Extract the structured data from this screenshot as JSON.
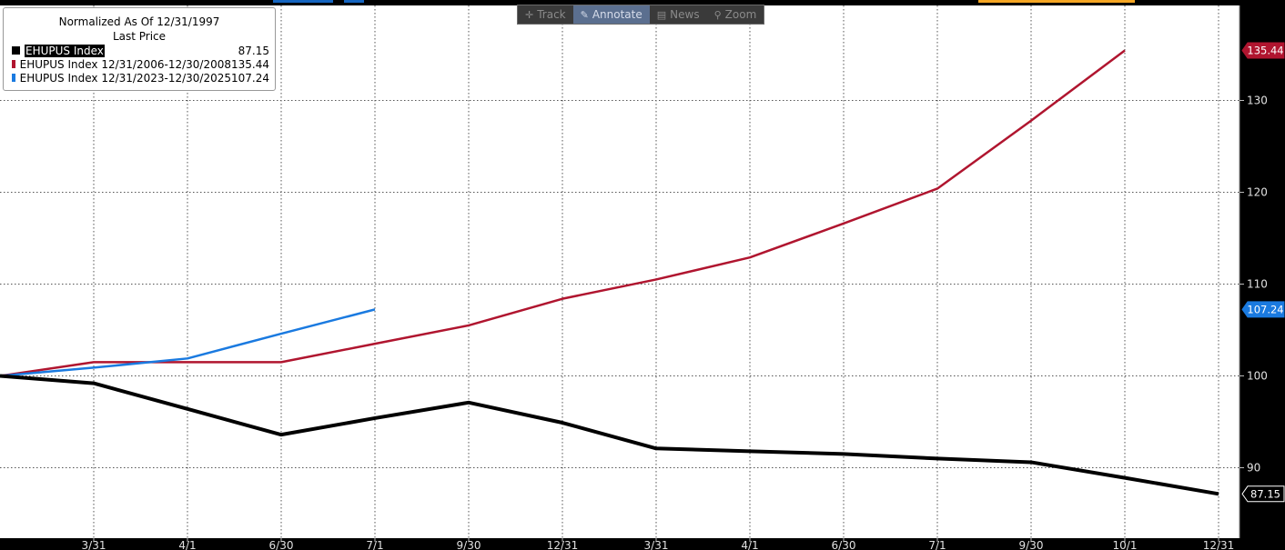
{
  "toolbar": {
    "track": "Track",
    "annotate": "Annotate",
    "news": "News",
    "zoom": "Zoom"
  },
  "legend": {
    "title": "Normalized As Of 12/31/1997",
    "subtitle": "Last Price",
    "rows": [
      {
        "name": "EHUPUS Index",
        "value": "87.15"
      },
      {
        "name": "EHUPUS Index 12/31/2006-12/30/2008",
        "value": "135.44"
      },
      {
        "name": "EHUPUS Index 12/31/2023-12/30/2025",
        "value": "107.24"
      }
    ]
  },
  "colors": {
    "background": "#000000",
    "series_black": "#000000",
    "series_red": "#b0152f",
    "series_blue": "#1a7ae0",
    "top_bar_blue": "#1565c0",
    "top_bar_orange": "#f5a623"
  },
  "chart_data": {
    "type": "line",
    "categories": [
      "12/31",
      "3/31",
      "4/1",
      "6/30",
      "7/1",
      "9/30",
      "12/31",
      "3/31",
      "4/1",
      "6/30",
      "7/1",
      "9/30",
      "10/1",
      "12/31"
    ],
    "ylim": [
      85,
      140
    ],
    "yticks": [
      90,
      100,
      110,
      120,
      130
    ],
    "grid": true,
    "legend_position": "top-left",
    "series": [
      {
        "name": "EHUPUS Index",
        "color": "#000000",
        "values": [
          100,
          99.2,
          96.4,
          93.6,
          95.4,
          97.1,
          94.9,
          92.1,
          91.8,
          91.5,
          91.0,
          90.6,
          88.9,
          87.15
        ]
      },
      {
        "name": "EHUPUS Index 12/31/2006-12/30/2008",
        "color": "#b0152f",
        "values": [
          100,
          101.5,
          101.5,
          101.5,
          103.5,
          105.5,
          108.4,
          110.5,
          112.9,
          116.6,
          120.4,
          127.8,
          135.44,
          null
        ]
      },
      {
        "name": "EHUPUS Index 12/31/2023-12/30/2025",
        "color": "#1a7ae0",
        "values": [
          100,
          100.9,
          101.9,
          104.6,
          107.24,
          null,
          null,
          null,
          null,
          null,
          null,
          null,
          null,
          null
        ]
      }
    ],
    "value_labels": [
      {
        "text": "135.44",
        "value": 135.44,
        "series": 1
      },
      {
        "text": "107.24",
        "value": 107.24,
        "series": 2
      },
      {
        "text": "87.15",
        "value": 87.15,
        "series": 0
      }
    ]
  }
}
